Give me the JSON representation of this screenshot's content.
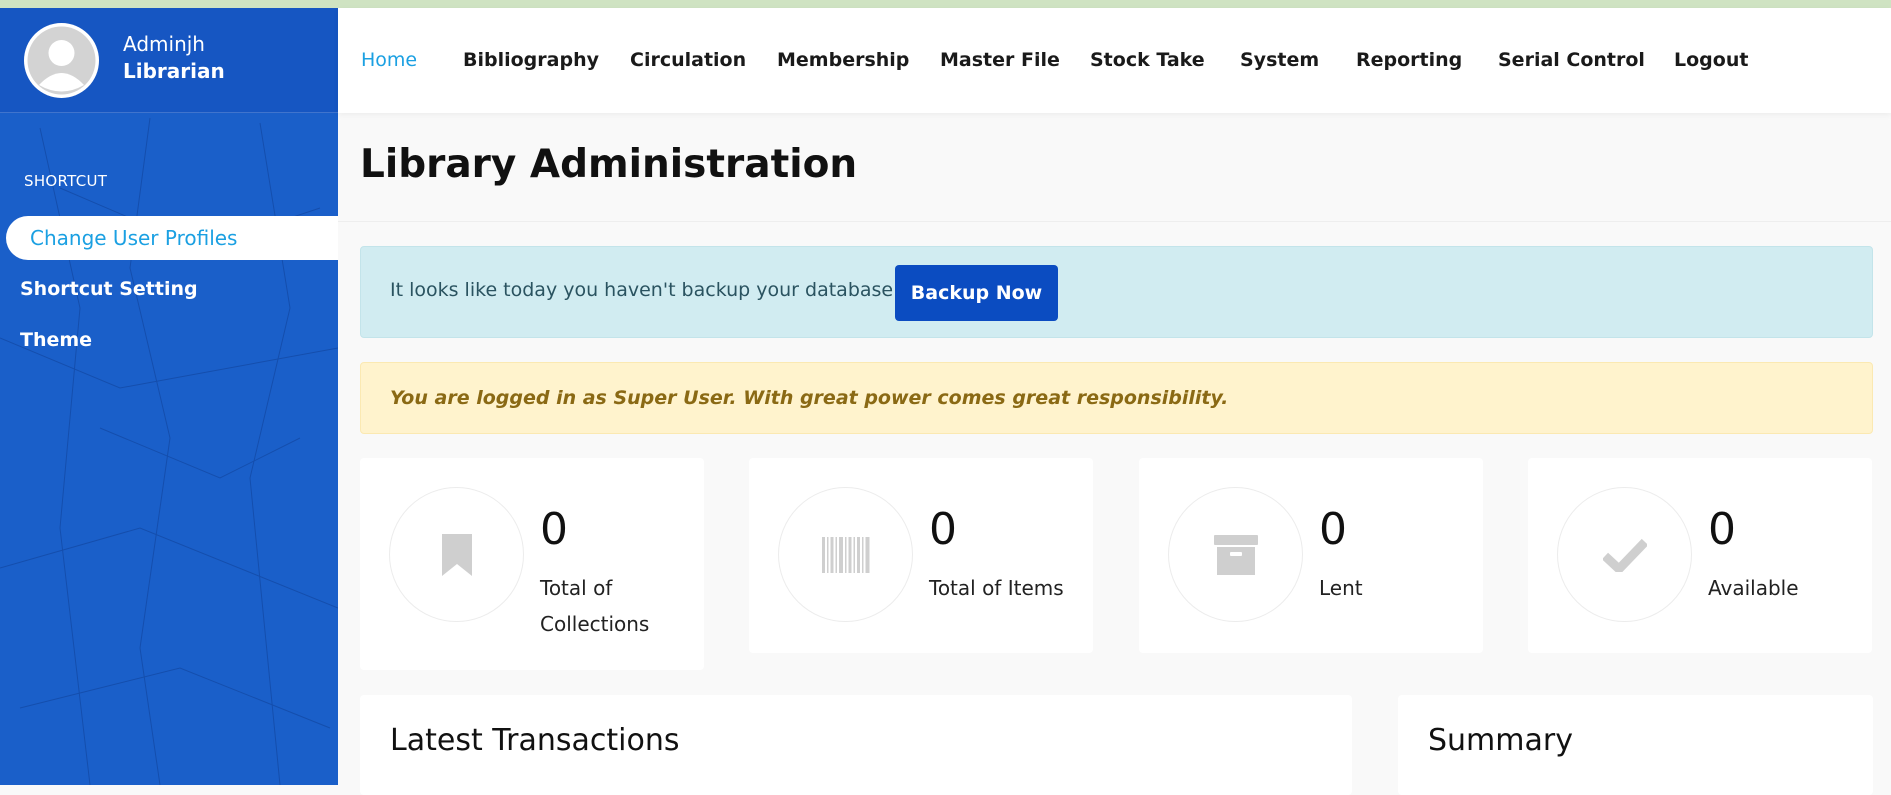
{
  "profile": {
    "name": "Adminjh",
    "role": "Librarian"
  },
  "sidebar": {
    "section_label": "SHORTCUT",
    "items": [
      {
        "label": "Change User Profiles",
        "active": true
      },
      {
        "label": "Shortcut Setting",
        "active": false
      },
      {
        "label": "Theme",
        "active": false
      }
    ]
  },
  "nav": {
    "items": [
      {
        "label": "Home",
        "active": true
      },
      {
        "label": "Bibliography",
        "active": false
      },
      {
        "label": "Circulation",
        "active": false
      },
      {
        "label": "Membership",
        "active": false
      },
      {
        "label": "Master File",
        "active": false
      },
      {
        "label": "Stock Take",
        "active": false
      },
      {
        "label": "System",
        "active": false
      },
      {
        "label": "Reporting",
        "active": false
      },
      {
        "label": "Serial Control",
        "active": false
      },
      {
        "label": "Logout",
        "active": false
      }
    ]
  },
  "page": {
    "title": "Library Administration"
  },
  "alerts": {
    "backup_text": "It looks like today you haven't backup your database..",
    "backup_button": "Backup Now",
    "superuser_text": "You are logged in as Super User. With great power comes great responsibility."
  },
  "stats": [
    {
      "value": "0",
      "label": "Total of Collections",
      "icon": "bookmark-icon"
    },
    {
      "value": "0",
      "label": "Total of Items",
      "icon": "barcode-icon"
    },
    {
      "value": "0",
      "label": "Lent",
      "icon": "archive-box-icon"
    },
    {
      "value": "0",
      "label": "Available",
      "icon": "checkmark-icon"
    }
  ],
  "panels": {
    "latest_transactions": "Latest Transactions",
    "summary": "Summary"
  },
  "colors": {
    "sidebar_bg": "#1a5fc9",
    "accent": "#1ba0e2",
    "button_primary": "#0b4cc1",
    "info_bg": "#d1ecf1",
    "warning_bg": "#fff3cd"
  }
}
